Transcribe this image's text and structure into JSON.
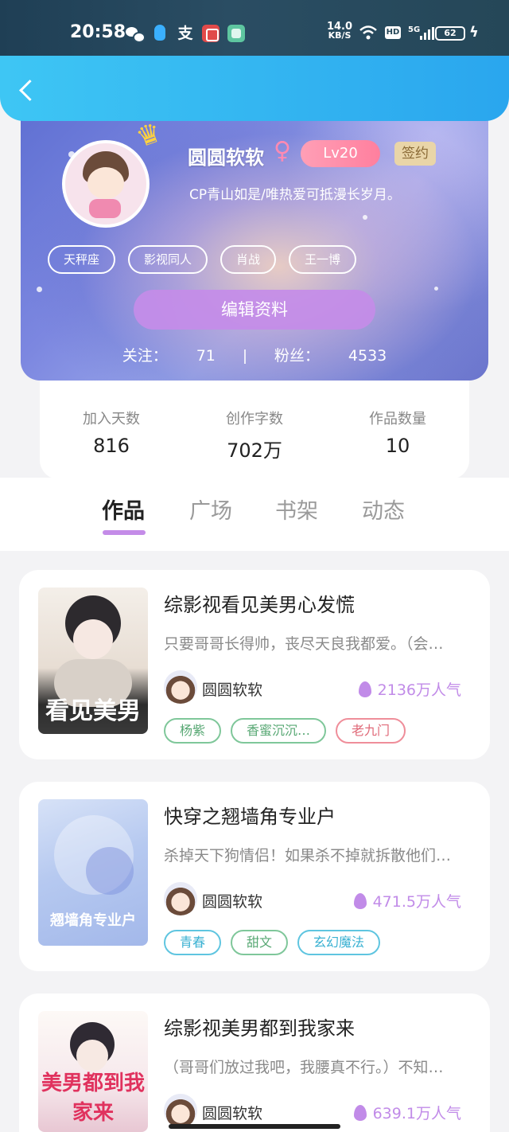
{
  "status_bar": {
    "time": "20:58",
    "net_speed_value": "14.0",
    "net_speed_unit": "KB/S",
    "hd": "HD",
    "network": "5G",
    "battery": "62",
    "icons": [
      "wechat-icon",
      "qq-icon",
      "alipay-icon",
      "app-icon",
      "app-icon",
      "wifi-icon",
      "signal-icon",
      "battery-icon",
      "charging-icon"
    ]
  },
  "header": {
    "back_icon": "chevron-left-icon"
  },
  "profile": {
    "name": "圆圆软软",
    "gender_symbol": "♀",
    "level": "Lv20",
    "signed_badge": "签约",
    "bio": "CP青山如是/唯热爱可抵漫长岁月。",
    "tags": [
      "天秤座",
      "影视同人",
      "肖战",
      "王一博"
    ],
    "edit_button": "编辑资料",
    "following_label": "关注：",
    "following_count": "71",
    "fans_label": "粉丝：",
    "fans_count": "4533"
  },
  "stats": [
    {
      "label": "加入天数",
      "value": "816"
    },
    {
      "label": "创作字数",
      "value": "702万"
    },
    {
      "label": "作品数量",
      "value": "10"
    }
  ],
  "tabs": [
    {
      "label": "作品",
      "active": true
    },
    {
      "label": "广场",
      "active": false
    },
    {
      "label": "书架",
      "active": false
    },
    {
      "label": "动态",
      "active": false
    }
  ],
  "works": [
    {
      "title": "综影视看见美男心发慌",
      "desc": "只要哥哥长得帅，丧尽天良我都爱。（会…",
      "author": "圆圆软软",
      "popularity": "2136万人气",
      "cover_text": "看见美男",
      "tags": [
        {
          "label": "杨紫",
          "color": "green"
        },
        {
          "label": "香蜜沉沉…",
          "color": "green"
        },
        {
          "label": "老九门",
          "color": "red"
        }
      ]
    },
    {
      "title": "快穿之翘墙角专业户",
      "desc": "杀掉天下狗情侣！如果杀不掉就拆散他们…",
      "author": "圆圆软软",
      "popularity": "471.5万人气",
      "cover_text": "翘墙角专业户",
      "tags": [
        {
          "label": "青春",
          "color": "blue"
        },
        {
          "label": "甜文",
          "color": "green"
        },
        {
          "label": "玄幻魔法",
          "color": "blue"
        }
      ]
    },
    {
      "title": "综影视美男都到我家来",
      "desc": "（哥哥们放过我吧，我腰真不行。）不知…",
      "author": "圆圆软软",
      "popularity": "639.1万人气",
      "cover_text": "美男都到我家来",
      "tags": []
    }
  ]
}
